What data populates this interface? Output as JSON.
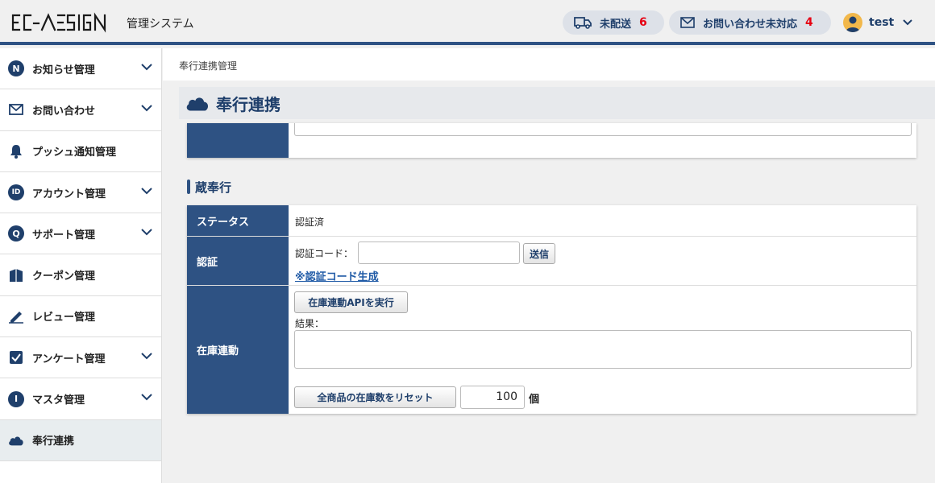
{
  "header": {
    "logo_text": "EC-DESIGN",
    "system_title": "管理システム",
    "undelivered_label": "未配送",
    "undelivered_count": "6",
    "inquiry_label": "お問い合わせ未対応",
    "inquiry_count": "4",
    "user_name": "test"
  },
  "sidebar": {
    "items": [
      {
        "label": "お知らせ管理",
        "icon": "N"
      },
      {
        "label": "お問い合わせ"
      },
      {
        "label": "プッシュ通知管理"
      },
      {
        "label": "アカウント管理",
        "icon": "ID"
      },
      {
        "label": "サポート管理",
        "icon": "Q"
      },
      {
        "label": "クーポン管理"
      },
      {
        "label": "レビュー管理"
      },
      {
        "label": "アンケート管理"
      },
      {
        "label": "マスタ管理",
        "icon": "I"
      },
      {
        "label": "奉行連携"
      }
    ]
  },
  "breadcrumb": "奉行連携管理",
  "page_title": "奉行連携",
  "section_title": "蔵奉行",
  "form": {
    "status_label": "ステータス",
    "status_value": "認証済",
    "auth_label": "認証",
    "auth_code_label": "認証コード：",
    "send_button": "送信",
    "generate_link": "※認証コード生成",
    "stock_label": "在庫連動",
    "run_api_button": "在庫連動APIを実行",
    "result_label": "結果：",
    "reset_button": "全商品の在庫数をリセット",
    "reset_quantity": "100",
    "unit": "個"
  },
  "colors": {
    "primary": "#2e5283",
    "accent_red": "#e60012",
    "link": "#1f5aa6"
  }
}
